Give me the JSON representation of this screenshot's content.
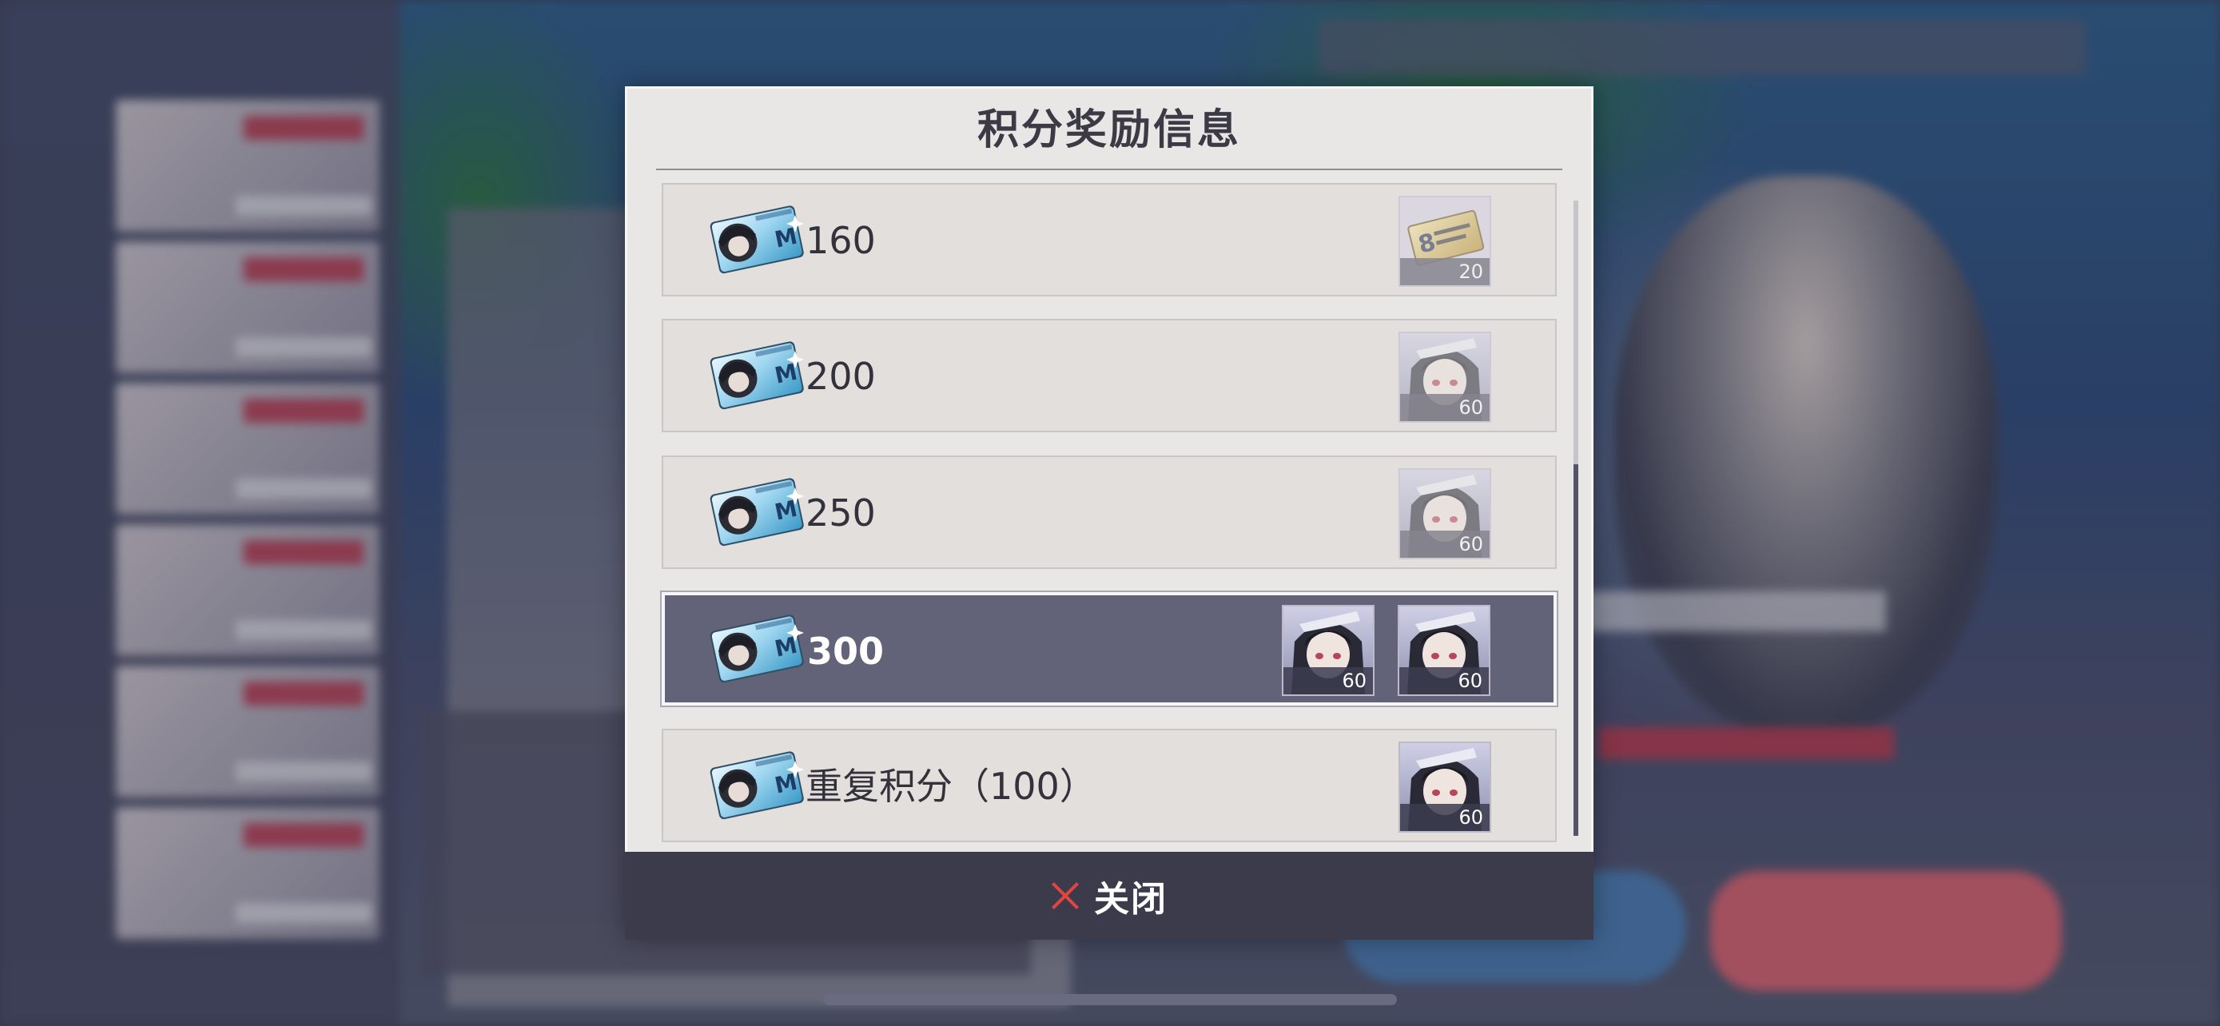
{
  "modal": {
    "title": "积分奖励信息",
    "close_label": "关闭",
    "rows": [
      {
        "score": "160",
        "rewards": [
          {
            "icon": "gold-ticket-item",
            "qty": "20"
          }
        ]
      },
      {
        "score": "200",
        "rewards": [
          {
            "icon": "character-avatar-item",
            "qty": "60"
          }
        ]
      },
      {
        "score": "250",
        "rewards": [
          {
            "icon": "character-avatar-item",
            "qty": "60"
          }
        ]
      },
      {
        "score": "300",
        "rewards": [
          {
            "icon": "character-avatar-item",
            "qty": "60"
          },
          {
            "icon": "character-avatar-item",
            "qty": "60"
          }
        ]
      },
      {
        "score": "重复积分（100）",
        "rewards": [
          {
            "icon": "character-avatar-item",
            "qty": "60"
          }
        ]
      }
    ]
  },
  "colors": {
    "selected_row": "#626378",
    "close_bar": "#3c3b4b",
    "close_icon": "#e2453f"
  }
}
